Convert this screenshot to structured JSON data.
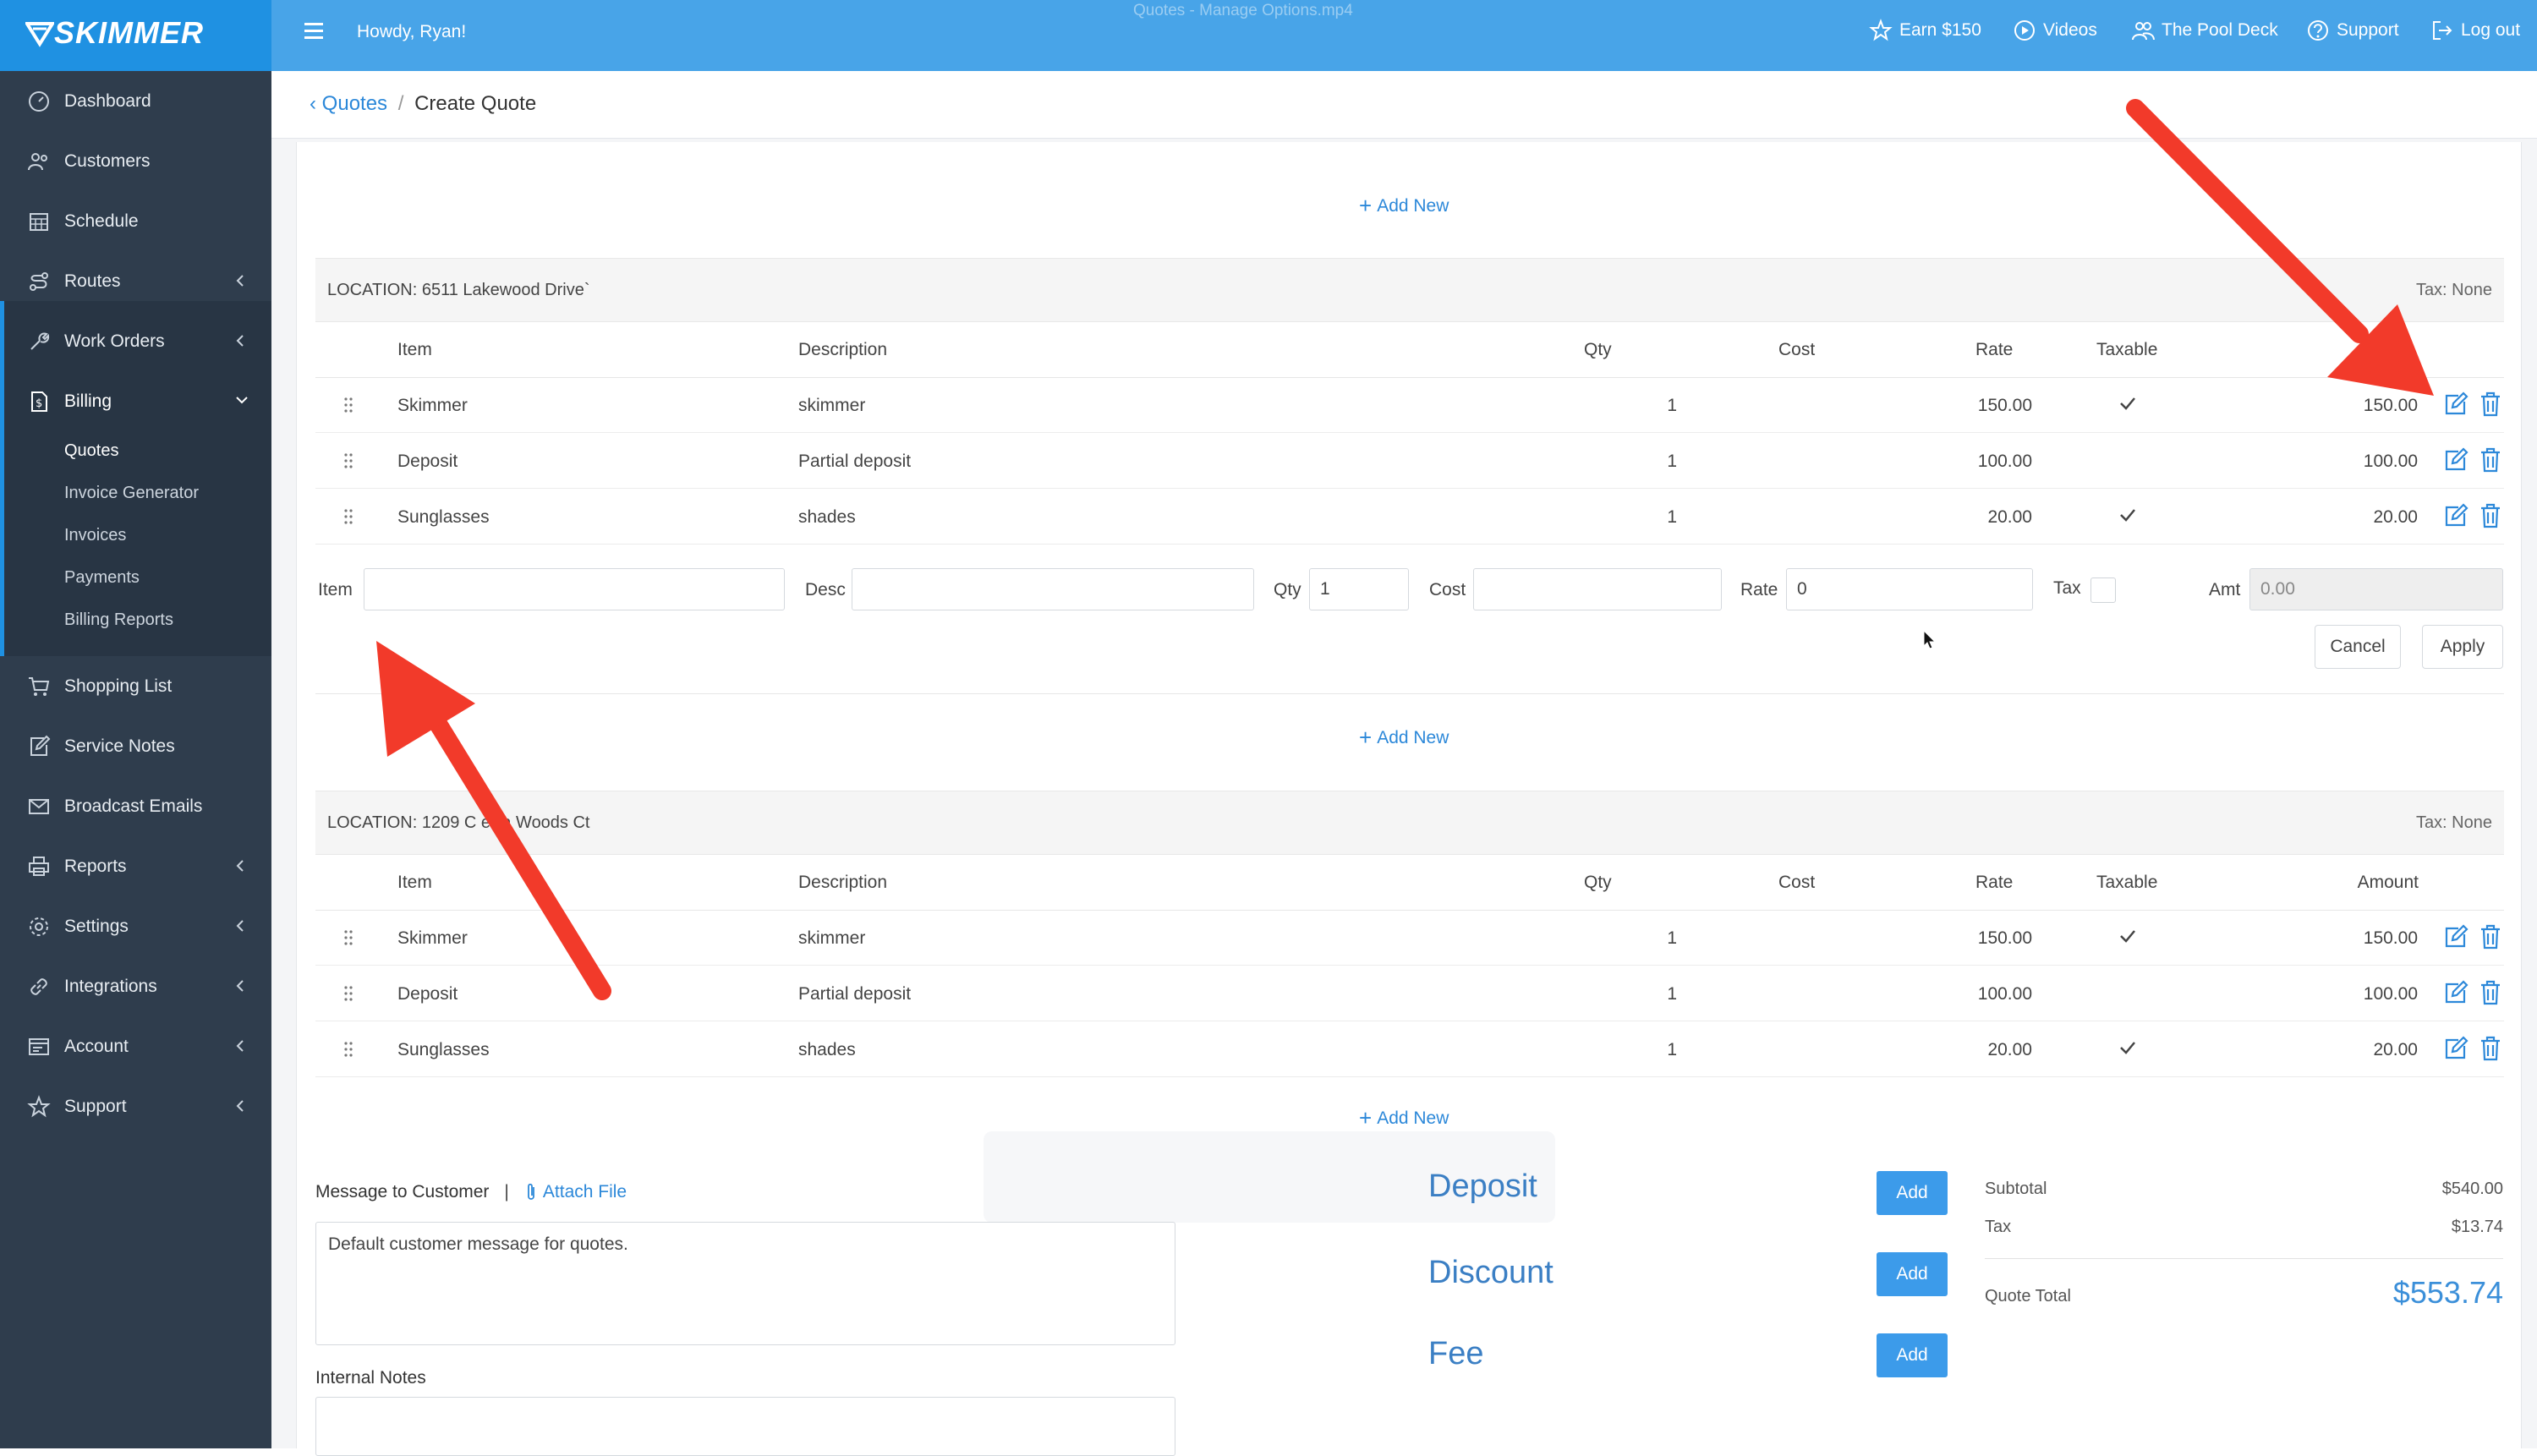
{
  "window": {
    "title": "Quotes - Manage Options.mp4"
  },
  "brand": {
    "name": "SKIMMER",
    "accent": "#1f91e2",
    "sidebar_bg": "#2f3d4d"
  },
  "topbar": {
    "greeting": "Howdy, Ryan!",
    "links": [
      {
        "label": "Earn $150",
        "icon": "star-icon"
      },
      {
        "label": "Videos",
        "icon": "play-circle-icon"
      },
      {
        "label": "The Pool Deck",
        "icon": "people-icon"
      },
      {
        "label": "Support",
        "icon": "help-circle-icon"
      },
      {
        "label": "Log out",
        "icon": "logout-icon"
      }
    ]
  },
  "sidebar": {
    "items": [
      {
        "label": "Dashboard"
      },
      {
        "label": "Customers"
      },
      {
        "label": "Schedule"
      },
      {
        "label": "Routes"
      },
      {
        "label": "Work Orders"
      },
      {
        "label": "Billing"
      },
      {
        "label": "Shopping List"
      },
      {
        "label": "Service Notes"
      },
      {
        "label": "Broadcast Emails"
      },
      {
        "label": "Reports"
      },
      {
        "label": "Settings"
      },
      {
        "label": "Integrations"
      },
      {
        "label": "Account"
      },
      {
        "label": "Support"
      }
    ],
    "billing_sub": [
      "Quotes",
      "Invoice Generator",
      "Invoices",
      "Payments",
      "Billing Reports"
    ]
  },
  "breadcrumb": {
    "parent": "Quotes",
    "separator": "/",
    "current": "Create Quote"
  },
  "add_new_label": "Add New",
  "columns": {
    "item": "Item",
    "description": "Description",
    "qty": "Qty",
    "cost": "Cost",
    "rate": "Rate",
    "taxable": "Taxable",
    "amount": "Amount"
  },
  "locations": [
    {
      "label": "LOCATION: 6511 Lakewood Drive`",
      "tax": "Tax: None",
      "rows": [
        {
          "item": "Skimmer",
          "description": "skimmer",
          "qty": "1",
          "rate": "150.00",
          "taxable": true,
          "amount": "150.00"
        },
        {
          "item": "Deposit",
          "description": "Partial deposit",
          "qty": "1",
          "rate": "100.00",
          "taxable": false,
          "amount": "100.00"
        },
        {
          "item": "Sunglasses",
          "description": "shades",
          "qty": "1",
          "rate": "20.00",
          "taxable": true,
          "amount": "20.00"
        }
      ]
    },
    {
      "label": "LOCATION: 1209 C   ellia Woods Ct",
      "tax": "Tax: None",
      "rows": [
        {
          "item": "Skimmer",
          "description": "skimmer",
          "qty": "1",
          "rate": "150.00",
          "taxable": true,
          "amount": "150.00"
        },
        {
          "item": "Deposit",
          "description": "Partial deposit",
          "qty": "1",
          "rate": "100.00",
          "taxable": false,
          "amount": "100.00"
        },
        {
          "item": "Sunglasses",
          "description": "shades",
          "qty": "1",
          "rate": "20.00",
          "taxable": true,
          "amount": "20.00"
        }
      ]
    }
  ],
  "line_form": {
    "item_label": "Item",
    "item_value": "",
    "desc_label": "Desc",
    "desc_value": "",
    "qty_label": "Qty",
    "qty_value": "1",
    "cost_label": "Cost",
    "cost_value": "",
    "rate_label": "Rate",
    "rate_value": "0",
    "tax_label": "Tax",
    "amt_label": "Amt",
    "amt_value": "0.00",
    "cancel_label": "Cancel",
    "apply_label": "Apply"
  },
  "message": {
    "label": "Message to Customer",
    "divider": "|",
    "attach_label": "Attach File",
    "text": "Default customer message for quotes."
  },
  "internal_notes_label": "Internal Notes",
  "adjustments": [
    {
      "label": "Deposit",
      "button": "Add"
    },
    {
      "label": "Discount",
      "button": "Add"
    },
    {
      "label": "Fee",
      "button": "Add"
    }
  ],
  "summary": {
    "subtotal_label": "Subtotal",
    "subtotal": "$540.00",
    "tax_label": "Tax",
    "tax": "$13.74",
    "total_label": "Quote Total",
    "total": "$553.74"
  },
  "annotation_color": "#f23a2a"
}
